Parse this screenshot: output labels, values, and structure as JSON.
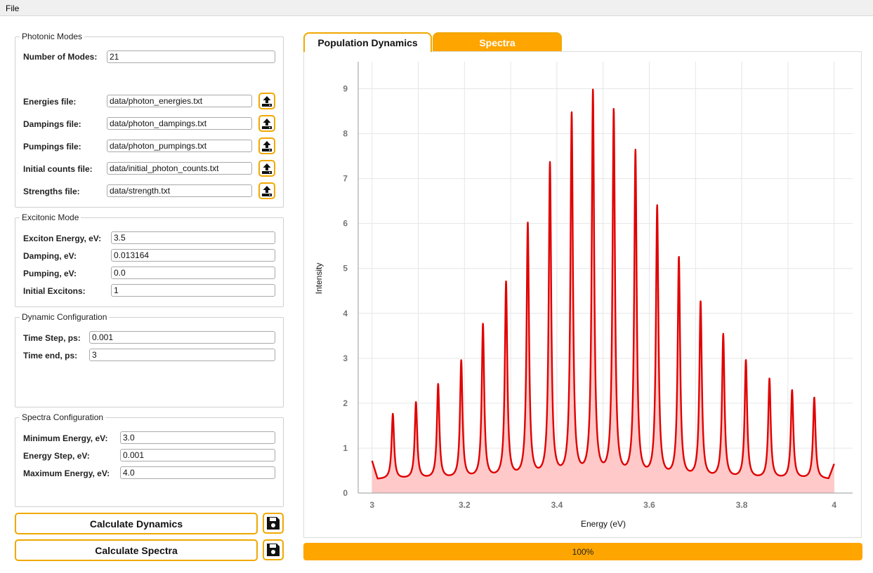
{
  "menu": {
    "file_label": "File"
  },
  "photonic": {
    "legend": "Photonic Modes",
    "num_modes_label": "Number of Modes:",
    "num_modes_value": "21",
    "files": [
      {
        "label": "Energies file:",
        "value": "data/photon_energies.txt"
      },
      {
        "label": "Dampings file:",
        "value": "data/photon_dampings.txt"
      },
      {
        "label": "Pumpings file:",
        "value": "data/photon_pumpings.txt"
      },
      {
        "label": "Initial counts file:",
        "value": "data/initial_photon_counts.txt"
      },
      {
        "label": "Strengths file:",
        "value": "data/strength.txt"
      }
    ]
  },
  "excitonic": {
    "legend": "Excitonic Mode",
    "rows": [
      {
        "label": "Exciton Energy, eV:",
        "value": "3.5"
      },
      {
        "label": "Damping, eV:",
        "value": "0.013164"
      },
      {
        "label": "Pumping, eV:",
        "value": "0.0"
      },
      {
        "label": "Initial Excitons:",
        "value": "1"
      }
    ]
  },
  "dynamic": {
    "legend": "Dynamic Configuration",
    "rows": [
      {
        "label": "Time Step, ps:",
        "value": "0.001"
      },
      {
        "label": "Time end, ps:",
        "value": "3"
      }
    ]
  },
  "spectra_cfg": {
    "legend": "Spectra Configuration",
    "rows": [
      {
        "label": "Minimum Energy, eV:",
        "value": "3.0"
      },
      {
        "label": "Energy Step, eV:",
        "value": "0.001"
      },
      {
        "label": "Maximum Energy, eV:",
        "value": "4.0"
      }
    ]
  },
  "actions": {
    "calc_dynamics": "Calculate Dynamics",
    "calc_spectra": "Calculate Spectra"
  },
  "tabs": [
    {
      "label": "Population Dynamics",
      "active": true
    },
    {
      "label": "Spectra",
      "active": false
    }
  ],
  "progress": {
    "text": "100%",
    "value": 1.0
  },
  "colors": {
    "accent": "#ffa500",
    "accent_border": "#f0a800",
    "line": "#e00000",
    "fill": "#ffc9c9"
  },
  "chart_data": {
    "type": "line",
    "xlabel": "Energy (eV)",
    "ylabel": "Intensity",
    "xlim": [
      2.97,
      4.04
    ],
    "ylim": [
      0,
      9.6
    ],
    "xticks": [
      3,
      3.2,
      3.4,
      3.6,
      3.8,
      4
    ],
    "xtick_labels": [
      "3",
      "3.2",
      "3.4",
      "3.6",
      "3.8",
      "4"
    ],
    "yticks": [
      0,
      1,
      2,
      3,
      4,
      5,
      6,
      7,
      8,
      9
    ],
    "ytick_labels": [
      "0",
      "1",
      "2",
      "3",
      "4",
      "5",
      "6",
      "7",
      "8",
      "9"
    ],
    "grid": true,
    "baseline": 0.3,
    "x_start": 3.0,
    "x_end": 4.0,
    "peaks": [
      {
        "x": 3.045,
        "y": 1.75
      },
      {
        "x": 3.095,
        "y": 2.0
      },
      {
        "x": 3.143,
        "y": 2.4
      },
      {
        "x": 3.193,
        "y": 2.92
      },
      {
        "x": 3.24,
        "y": 3.72
      },
      {
        "x": 3.29,
        "y": 4.65
      },
      {
        "x": 3.337,
        "y": 5.95
      },
      {
        "x": 3.385,
        "y": 7.28
      },
      {
        "x": 3.432,
        "y": 8.38
      },
      {
        "x": 3.478,
        "y": 8.88
      },
      {
        "x": 3.523,
        "y": 8.45
      },
      {
        "x": 3.57,
        "y": 7.55
      },
      {
        "x": 3.617,
        "y": 6.33
      },
      {
        "x": 3.664,
        "y": 5.2
      },
      {
        "x": 3.711,
        "y": 4.22
      },
      {
        "x": 3.76,
        "y": 3.5
      },
      {
        "x": 3.809,
        "y": 2.93
      },
      {
        "x": 3.86,
        "y": 2.52
      },
      {
        "x": 3.909,
        "y": 2.27
      },
      {
        "x": 3.957,
        "y": 2.11
      }
    ],
    "edge_values": {
      "start": 0.72,
      "end": 0.65
    }
  }
}
